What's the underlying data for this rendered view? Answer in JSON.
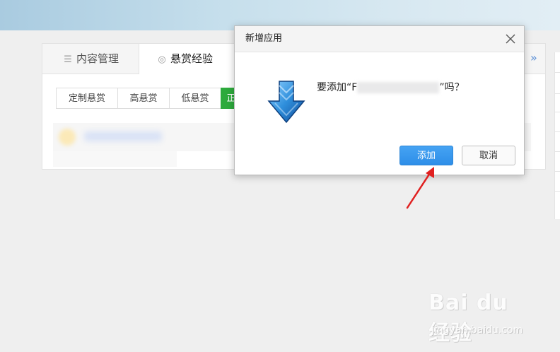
{
  "tabs": [
    {
      "label": "内容管理",
      "icon": "list-icon"
    },
    {
      "label": "悬赏经验",
      "icon": "reward-icon"
    }
  ],
  "more_label": "»",
  "subtabs": [
    "定制悬赏",
    "高悬赏",
    "低悬赏",
    "正"
  ],
  "dialog": {
    "title": "新增应用",
    "message_prefix": "要添加“F",
    "message_suffix": "”吗？",
    "add_label": "添加",
    "cancel_label": "取消"
  },
  "watermark": {
    "brand": "Bai du 经验",
    "url": "jingyan.baidu.com"
  },
  "colors": {
    "accent_green": "#2daa3c",
    "primary_blue": "#2e8ee8",
    "arrow_red": "#e02020"
  }
}
